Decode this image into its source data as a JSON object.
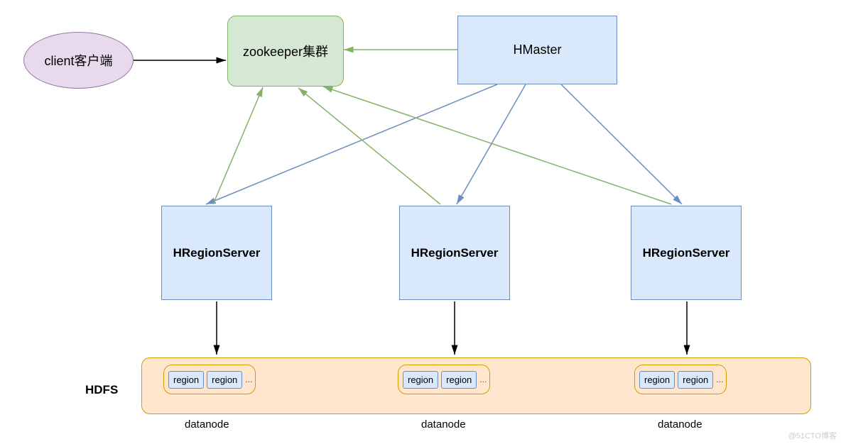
{
  "client": {
    "label": "client客户端"
  },
  "zookeeper": {
    "label": "zookeeper集群"
  },
  "hmaster": {
    "label": "HMaster"
  },
  "region_servers": {
    "rs1": {
      "label": "HRegionServer"
    },
    "rs2": {
      "label": "HRegionServer"
    },
    "rs3": {
      "label": "HRegionServer"
    }
  },
  "hdfs": {
    "label": "HDFS",
    "datanodes": {
      "d1": {
        "label": "datanode",
        "regions": [
          "region",
          "region"
        ],
        "ellipsis": "..."
      },
      "d2": {
        "label": "datanode",
        "regions": [
          "region",
          "region"
        ],
        "ellipsis": "..."
      },
      "d3": {
        "label": "datanode",
        "regions": [
          "region",
          "region"
        ],
        "ellipsis": "..."
      }
    }
  },
  "watermark": "@51CTO博客"
}
